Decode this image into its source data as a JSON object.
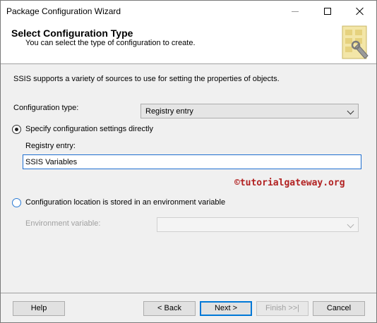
{
  "window": {
    "title": "Package Configuration Wizard"
  },
  "header": {
    "title": "Select Configuration Type",
    "subtitle": "You can select the type of configuration to create."
  },
  "description": "SSIS supports a variety of sources to use for setting the properties of objects.",
  "config_type": {
    "label": "Configuration type:",
    "selected": "Registry entry"
  },
  "option_direct": {
    "label": "Specify configuration settings directly",
    "checked": true,
    "registry_label": "Registry entry:",
    "registry_value": "SSIS Variables"
  },
  "watermark": "©tutorialgateway.org",
  "option_env": {
    "label": "Configuration location is stored in an environment variable",
    "checked": false,
    "env_label": "Environment variable:",
    "env_value": ""
  },
  "buttons": {
    "help": "Help",
    "back": "< Back",
    "next": "Next >",
    "finish": "Finish >>|",
    "cancel": "Cancel"
  }
}
